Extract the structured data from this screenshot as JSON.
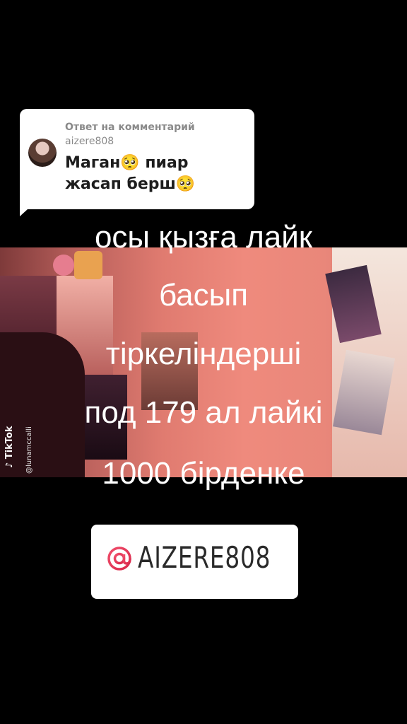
{
  "reply": {
    "label": "Ответ на комментарий",
    "username": "aizere808",
    "text": "Маган🥺 пиар жасап берш🥺"
  },
  "caption": {
    "line1": "осы қызға лайк",
    "line2": "басып",
    "line3": "тіркеліндерші",
    "line4": "под 179 ал лайкі",
    "line5": "1000 бірденке"
  },
  "watermark": {
    "app": "TikTok",
    "handle": "@lunamccalli"
  },
  "sticker": {
    "handle": "AIZERE808",
    "accent_color": "#e8385a"
  }
}
